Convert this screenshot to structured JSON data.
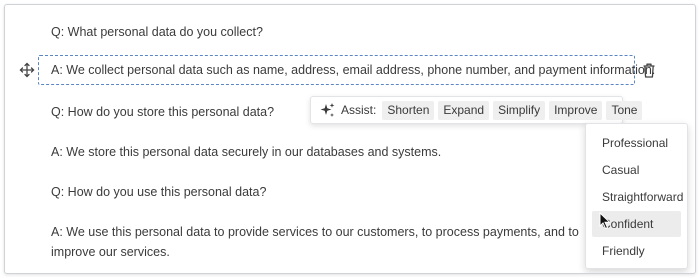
{
  "content": {
    "paragraphs": [
      "Q: What personal data do you collect?",
      "A: We collect personal data such as name, address, email address, phone number, and payment information.",
      "Q: How do you store this personal data?",
      "A: We store this personal data securely in our databases and systems.",
      "Q: How do you use this personal data?",
      "A: We use this personal data to provide services to our customers, to process payments, and to improve our services."
    ]
  },
  "assist": {
    "label": "Assist:",
    "buttons": [
      "Shorten",
      "Expand",
      "Simplify",
      "Improve",
      "Tone"
    ]
  },
  "tone_menu": {
    "items": [
      "Professional",
      "Casual",
      "Straightforward",
      "Confident",
      "Friendly"
    ],
    "hovered": "Confident"
  },
  "colors": {
    "selection_border": "#5b86c6",
    "hover_bg": "#ececec",
    "chip_bg": "#efefef"
  },
  "icons": {
    "assist": "sparkle-icon",
    "move": "move-icon",
    "delete": "trash-icon",
    "pointer": "mouse-pointer-icon"
  }
}
